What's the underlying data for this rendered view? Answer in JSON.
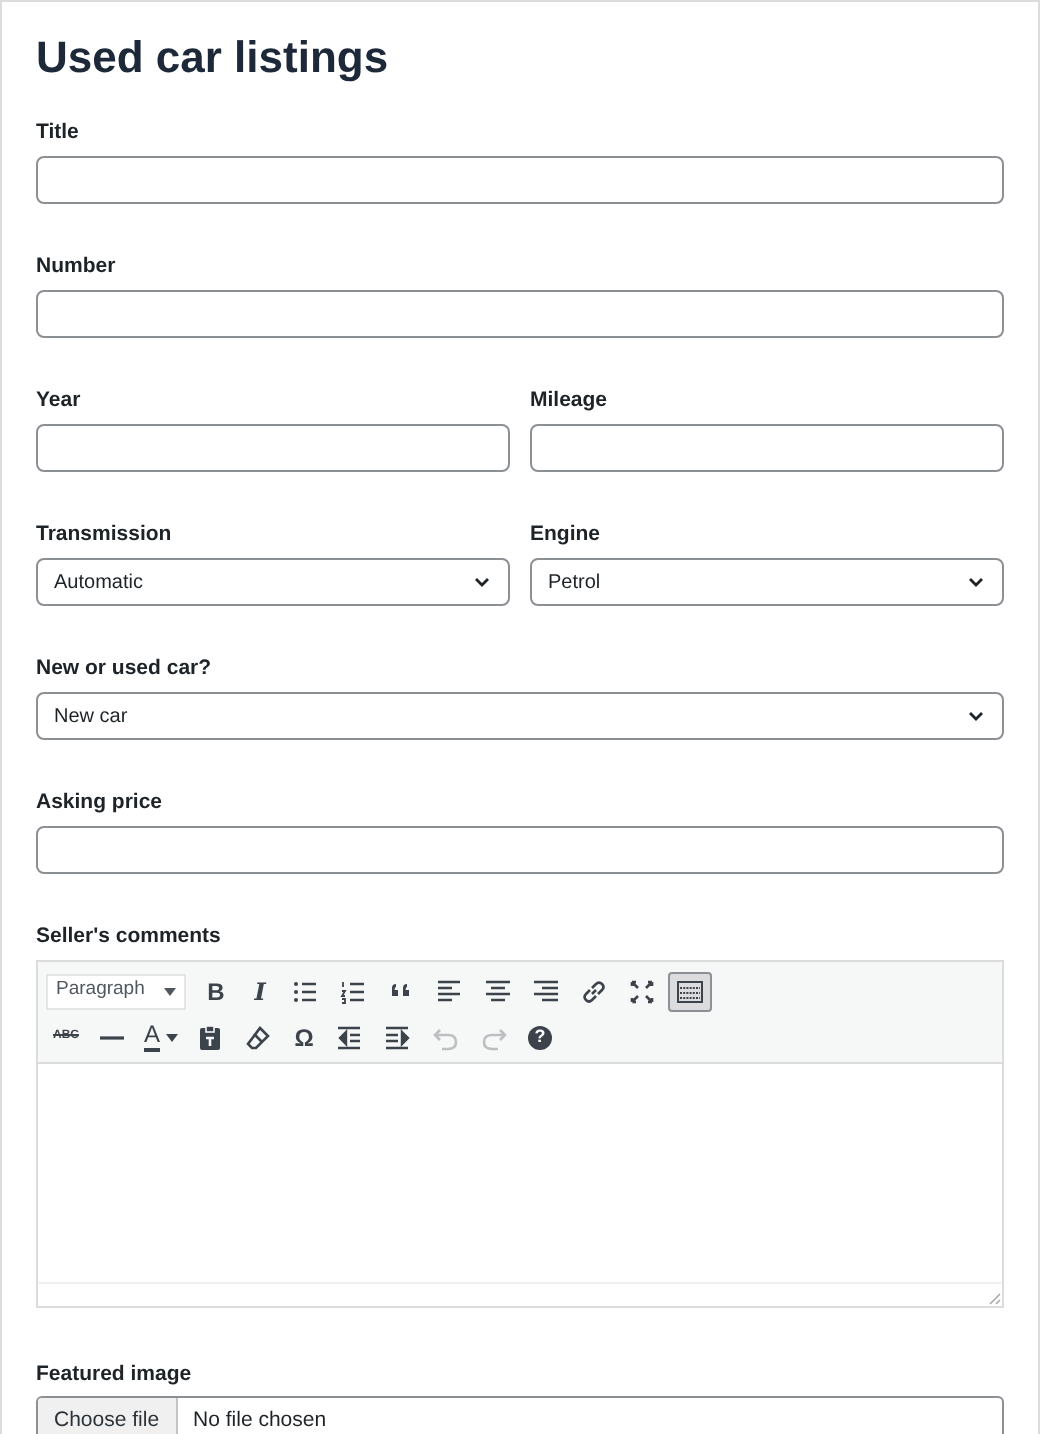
{
  "heading": "Used car listings",
  "rows": [
    [
      {
        "label": "Title",
        "kind": "text"
      }
    ],
    [
      {
        "label": "Number",
        "kind": "text"
      }
    ],
    [
      {
        "label": "Year",
        "kind": "text"
      },
      {
        "label": "Mileage",
        "kind": "text"
      }
    ],
    [
      {
        "label": "Transmission",
        "kind": "select",
        "value": "Automatic"
      },
      {
        "label": "Engine",
        "kind": "select",
        "value": "Petrol"
      }
    ],
    [
      {
        "label": "New or used car?",
        "kind": "select",
        "value": "New car"
      }
    ],
    [
      {
        "label": "Asking price",
        "kind": "text"
      }
    ]
  ],
  "editor": {
    "label": "Seller's comments",
    "format": "Paragraph",
    "toolbar": [
      [
        {
          "kind": "text",
          "text": "B",
          "active": false,
          "disabled": false
        },
        {
          "kind": "text",
          "text": "I",
          "active": false,
          "disabled": false
        },
        {
          "kind": "icon",
          "active": false,
          "disabled": false
        },
        {
          "kind": "icon",
          "active": false,
          "disabled": false
        },
        {
          "kind": "icon",
          "active": false,
          "disabled": false
        },
        {
          "kind": "icon",
          "active": false,
          "disabled": false
        },
        {
          "kind": "icon",
          "active": false,
          "disabled": false
        },
        {
          "kind": "icon",
          "active": false,
          "disabled": false
        },
        {
          "kind": "icon",
          "active": false,
          "disabled": false
        },
        {
          "kind": "icon",
          "active": false,
          "disabled": false
        },
        {
          "kind": "icon",
          "active": true,
          "disabled": false
        }
      ],
      [
        {
          "kind": "strike",
          "text": "ABC",
          "active": false,
          "disabled": false
        },
        {
          "kind": "icon",
          "active": false,
          "disabled": false
        },
        {
          "kind": "color",
          "text": "A",
          "active": false,
          "disabled": false
        },
        {
          "kind": "icon",
          "active": false,
          "disabled": false
        },
        {
          "kind": "icon",
          "active": false,
          "disabled": false
        },
        {
          "kind": "text",
          "text": "Ω",
          "active": false,
          "disabled": false
        },
        {
          "kind": "icon",
          "active": false,
          "disabled": false
        },
        {
          "kind": "icon",
          "active": false,
          "disabled": false
        },
        {
          "kind": "icon",
          "active": false,
          "disabled": true
        },
        {
          "kind": "icon",
          "active": false,
          "disabled": true
        },
        {
          "kind": "help",
          "text": "?",
          "active": false,
          "disabled": false
        }
      ]
    ]
  },
  "featured_image": {
    "label": "Featured image",
    "button": "Choose file",
    "status": "No file chosen"
  }
}
